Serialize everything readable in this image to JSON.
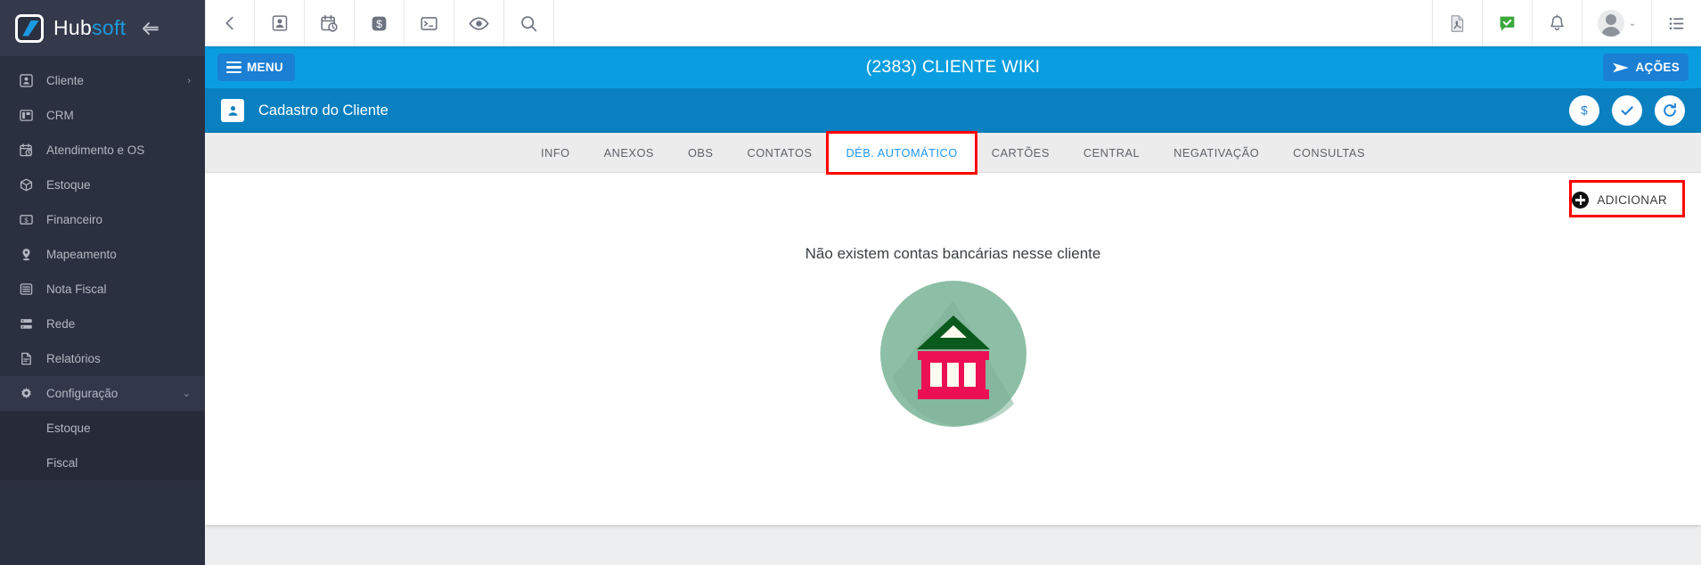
{
  "brand": {
    "name_part1": "Hub",
    "name_part2": "soft",
    "collapse_icon": "collapse-arrow-icon"
  },
  "sidebar": {
    "items": [
      {
        "label": "Cliente",
        "icon": "person-badge-icon",
        "arrow": "›",
        "sub": false
      },
      {
        "label": "CRM",
        "icon": "kanban-icon",
        "arrow": "",
        "sub": false
      },
      {
        "label": "Atendimento e OS",
        "icon": "calendar-clock-icon",
        "arrow": "",
        "sub": false
      },
      {
        "label": "Estoque",
        "icon": "box-icon",
        "arrow": "",
        "sub": false
      },
      {
        "label": "Financeiro",
        "icon": "money-bill-icon",
        "arrow": "",
        "sub": false
      },
      {
        "label": "Mapeamento",
        "icon": "map-pin-icon",
        "arrow": "",
        "sub": false
      },
      {
        "label": "Nota Fiscal",
        "icon": "document-lines-icon",
        "arrow": "",
        "sub": false
      },
      {
        "label": "Rede",
        "icon": "server-icon",
        "arrow": "",
        "sub": false
      },
      {
        "label": "Relatórios",
        "icon": "report-file-icon",
        "arrow": "",
        "sub": false
      },
      {
        "label": "Configuração",
        "icon": "gear-icon",
        "arrow": "⌄",
        "sub": false
      },
      {
        "label": "Estoque",
        "icon": "",
        "arrow": "",
        "sub": true
      },
      {
        "label": "Fiscal",
        "icon": "",
        "arrow": "",
        "sub": true
      }
    ]
  },
  "toolbar": {
    "left_icons": [
      "back-arrow-icon",
      "contact-card-icon",
      "calendar-clock-icon",
      "dollar-badge-icon",
      "terminal-icon",
      "eye-icon",
      "search-icon"
    ],
    "right_icons": [
      "pdf-file-icon",
      "green-check-chat-icon",
      "bell-icon"
    ],
    "avatar_icon": "user-avatar",
    "avatar_caret": "⌄",
    "list-menu_icon": "list-menu-icon"
  },
  "titlebar": {
    "menu_label": "MENU",
    "page_title": "(2383) CLIENTE WIKI",
    "actions_label": "AÇÕES",
    "actions_icon": "send-plane-icon",
    "menu_icon": "hamburger-icon"
  },
  "subheader": {
    "title": "Cadastro do Cliente",
    "icon": "person-badge-icon",
    "round_buttons": [
      {
        "icon": "dollar-icon",
        "name": "finance-button"
      },
      {
        "icon": "check-icon",
        "name": "approve-button"
      },
      {
        "icon": "refresh-icon",
        "name": "refresh-button"
      }
    ]
  },
  "tabs": [
    {
      "label": "INFO",
      "active": false
    },
    {
      "label": "ANEXOS",
      "active": false
    },
    {
      "label": "OBS",
      "active": false
    },
    {
      "label": "CONTATOS",
      "active": false
    },
    {
      "label": "DÉB. AUTOMÁTICO",
      "active": true
    },
    {
      "label": "CARTÕES",
      "active": false
    },
    {
      "label": "CENTRAL",
      "active": false
    },
    {
      "label": "NEGATIVAÇÃO",
      "active": false
    },
    {
      "label": "CONSULTAS",
      "active": false
    }
  ],
  "content": {
    "add_label": "ADICIONAR",
    "add_icon": "plus-circle-icon",
    "empty_message": "Não existem contas bancárias nesse cliente",
    "empty_icon": "bank-illustration"
  },
  "colors": {
    "sidebar_bg": "#2b3040",
    "title_bar": "#0a9ee0",
    "subheader": "#0a80c0",
    "accent_blue": "#1b7fd4",
    "active_tab_text": "#2196f3",
    "annotation_red": "#ff0000",
    "bank_circle": "#8cbfa5",
    "bank_roof": "#0a5a1e",
    "bank_columns": "#ec0f53",
    "bank_cream": "#fdfaf0"
  }
}
